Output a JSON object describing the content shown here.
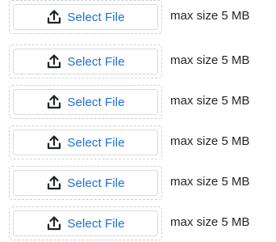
{
  "upload_rows": [
    {
      "button_label": "Select File",
      "icon": "upload-icon",
      "hint": "max size 5 MB"
    },
    {
      "button_label": "Select File",
      "icon": "upload-icon",
      "hint": "max size 5 MB"
    },
    {
      "button_label": "Select File",
      "icon": "upload-icon",
      "hint": "max size 5 MB"
    },
    {
      "button_label": "Select File",
      "icon": "upload-icon",
      "hint": "max size 5 MB"
    },
    {
      "button_label": "Select File",
      "icon": "upload-icon",
      "hint": "max size 5 MB"
    },
    {
      "button_label": "Select File",
      "icon": "upload-icon",
      "hint": "max size 5 MB"
    }
  ],
  "colors": {
    "accent": "#1b6fd8",
    "icon": "#1f2329",
    "text": "#1f2329",
    "dashed_border": "#cdd0d6",
    "button_border": "#d7dbe2"
  }
}
